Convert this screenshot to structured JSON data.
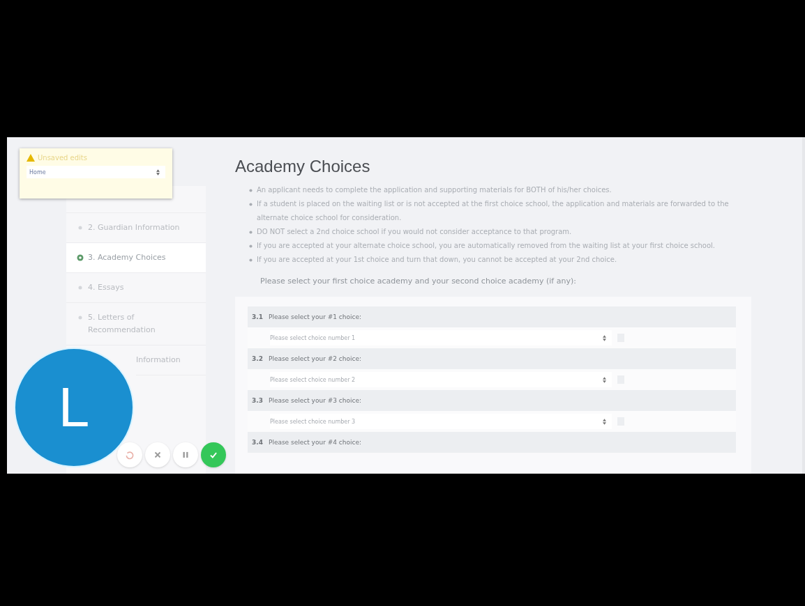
{
  "warning": {
    "title": "Unsaved edits",
    "select_value": "Home"
  },
  "sidebar": {
    "items": [
      {
        "label": "2. Guardian Information",
        "selected": false
      },
      {
        "label": "3. Academy Choices",
        "selected": true
      },
      {
        "label": "4. Essays",
        "selected": false
      },
      {
        "label": "5. Letters of Recommendation",
        "selected": false
      },
      {
        "label": "Information",
        "selected": false
      }
    ]
  },
  "page": {
    "title": "Academy Choices",
    "bullets": [
      "An applicant needs to complete the application and supporting materials for BOTH of his/her choices.",
      "If a student is placed on the waiting list or is not accepted at the first choice school, the application and materials are forwarded to the alternate choice school for consideration.",
      "DO NOT select a 2nd choice school if you would not consider acceptance to that program.",
      "If you are accepted at your alternate choice school, you are automatically removed from the waiting list at your first choice school.",
      "If you are accepted at your 1st choice and turn that down, you cannot be accepted at your 2nd choice."
    ],
    "prompt": "Please select your first choice academy and your second choice academy (if any):"
  },
  "questions": [
    {
      "number": "3.1",
      "label": "Please select your #1 choice:",
      "placeholder": "Please select choice number 1"
    },
    {
      "number": "3.2",
      "label": "Please select your #2 choice:",
      "placeholder": "Please select choice number 2"
    },
    {
      "number": "3.3",
      "label": "Please select your #3 choice:",
      "placeholder": "Please select choice number 3"
    },
    {
      "number": "3.4",
      "label": "Please select your #4 choice:"
    }
  ],
  "recorder": {
    "avatar": "L"
  }
}
